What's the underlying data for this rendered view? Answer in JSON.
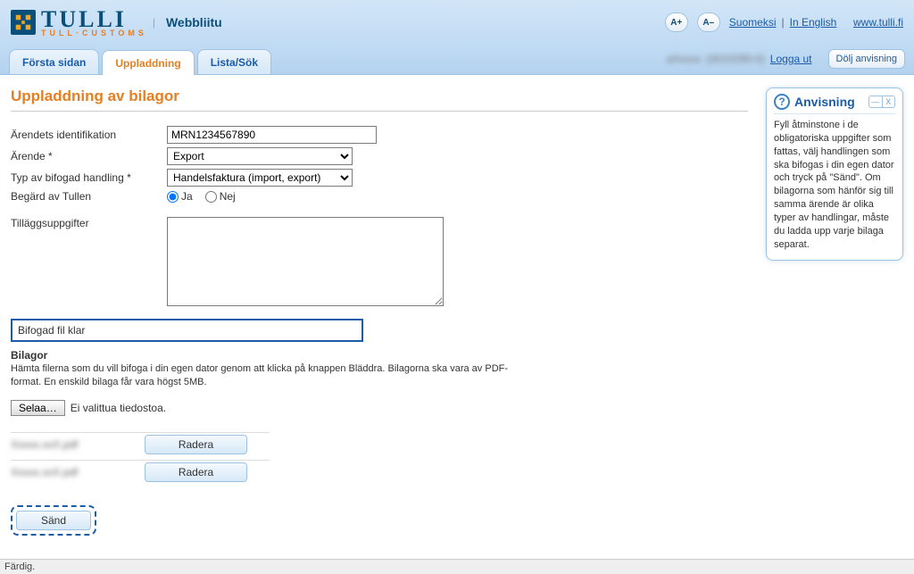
{
  "header": {
    "logo_main": "TULLI",
    "logo_sub": "TULL·CUSTOMS",
    "service": "Webbliitu",
    "text_increase": "A+",
    "text_decrease": "A–",
    "lang1": "Suomeksi",
    "lang2": "In English",
    "site_link": "www.tulli.fi"
  },
  "tabs": {
    "t0": "Första sidan",
    "t1": "Uppladdning",
    "t2": "Lista/Sök"
  },
  "user_row": {
    "user_blur": "aXxxxx",
    "user_id": "(0010290-0)",
    "logout": "Logga ut",
    "hide_instructions": "Dölj anvisning"
  },
  "page": {
    "title": "Uppladdning av bilagor"
  },
  "form": {
    "ident_label": "Ärendets identifikation",
    "ident_value": "MRN1234567890",
    "arende_label": "Ärende *",
    "arende_value": "Export",
    "type_label": "Typ av bifogad handling *",
    "type_value": "Handelsfaktura (import, export)",
    "requested_label": "Begärd av Tullen",
    "radio_yes": "Ja",
    "radio_no": "Nej",
    "extra_label": "Tilläggsuppgifter",
    "info_box": "Bifogad fil klar",
    "bilagor_label": "Bilagor",
    "bilagor_help": "Hämta filerna som du vill bifoga i din egen dator genom att klicka på knappen Bläddra. Bilagorna ska vara av PDF-format. En enskild bilaga får vara högst 5MB.",
    "browse_btn": "Selaa…",
    "no_file": "Ei valittua tiedostoa.",
    "delete_btn": "Radera",
    "file1": "Xxxxx.xxX.pdf",
    "file2": "Xxxxx.xxX.pdf",
    "send_btn": "Sänd"
  },
  "instructions": {
    "title": "Anvisning",
    "body": "Fyll åtminstone i de obligatoriska uppgifter som fattas, välj handlingen som ska bifogas i din egen dator och tryck på \"Sänd\". Om bilagorna som hänför sig till samma ärende är olika typer av handlingar, måste du ladda upp varje bilaga separat."
  },
  "footer": {
    "status": "Färdig."
  }
}
